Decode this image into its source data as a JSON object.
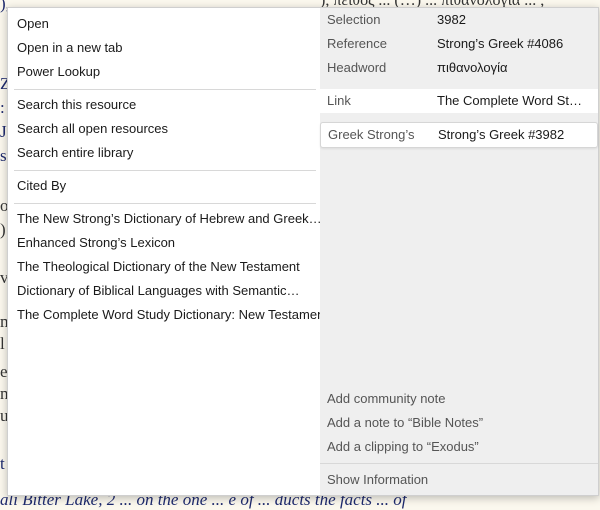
{
  "background": {
    "left_fragments": [
      "),",
      "Z",
      ":",
      "J",
      "s.",
      "ol",
      ")",
      "ve",
      "m",
      "l",
      "e",
      "n",
      "u",
      "t"
    ],
    "top_text": "), πειθός ... (…) ... πιθανολογία ... ,",
    "bottom_text": "ali Bitter Lake, 2 ... on the one ... e of ... ducts the facts ... of"
  },
  "menu": {
    "group1": [
      "Open",
      "Open in a new tab",
      "Power Lookup"
    ],
    "group2": [
      "Search this resource",
      "Search all open resources",
      "Search entire library"
    ],
    "group3": [
      "Cited By"
    ],
    "resources": [
      "The New Strong’s Dictionary of Hebrew and Greek…",
      "Enhanced Strong’s Lexicon",
      "The Theological Dictionary of the New Testament",
      "Dictionary of Biblical Languages with Semantic…",
      "The Complete Word Study Dictionary: New Testament"
    ]
  },
  "info": {
    "selection_label": "Selection",
    "selection_value": "3982",
    "reference_label": "Reference",
    "reference_value": "Strong’s Greek #4086",
    "headword_label": "Headword",
    "headword_value": "πιθανολογία",
    "link_label": "Link",
    "link_value": "The Complete Word Stud…",
    "greek_label": "Greek Strong’s",
    "greek_value": "Strong’s Greek #3982"
  },
  "actions": {
    "add_community_note": "Add community note",
    "add_note": "Add a note to “Bible Notes”",
    "add_clipping": "Add a clipping to “Exodus”",
    "show_information": "Show Information"
  }
}
